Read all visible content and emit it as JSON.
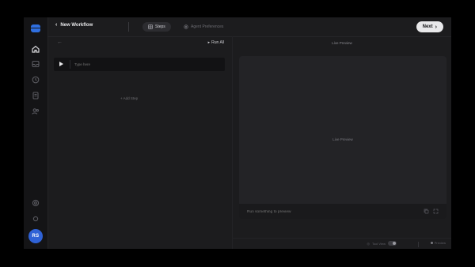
{
  "header": {
    "back_label": "New Workflow",
    "tabs": [
      {
        "label": "Steps",
        "active": true
      },
      {
        "label": "Agent Preferences",
        "active": false
      }
    ],
    "next_label": "Next"
  },
  "sidebar": {
    "items": [
      {
        "icon": "home-icon",
        "active": true
      },
      {
        "icon": "inbox-icon",
        "active": false
      },
      {
        "icon": "history-icon",
        "active": false
      },
      {
        "icon": "document-icon",
        "active": false
      },
      {
        "icon": "users-icon",
        "active": false
      }
    ],
    "bottom_items": [
      {
        "icon": "settings-icon"
      },
      {
        "icon": "help-icon"
      }
    ],
    "avatar_initials": "RS"
  },
  "steps": {
    "run_all_label": "Run All",
    "items": [
      {
        "placeholder": "Type here"
      }
    ],
    "add_step_label": "+ Add Step"
  },
  "preview": {
    "title": "Live Preview",
    "center_label": "Live Preview",
    "input_placeholder": "Run something to preview",
    "tool_view_label": "Tool View",
    "preview_label": "Preview"
  },
  "colors": {
    "accent": "#2f6fe0",
    "avatar": "#2f62d6",
    "background": "#1c1c1e",
    "sidebar": "#141416"
  }
}
